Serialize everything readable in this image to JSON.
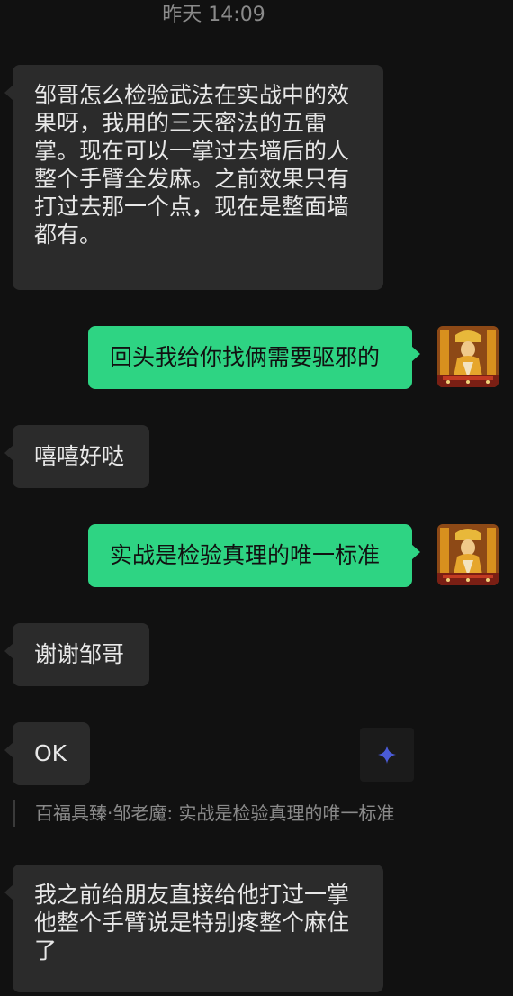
{
  "chat": {
    "timestamp": "昨天 14:09",
    "messages": [
      {
        "side": "in",
        "text": "邹哥怎么检验武法在实战中的效果呀，我用的三天密法的五雷掌。现在可以一掌过去墙后的人整个手臂全发麻。之前效果只有打过去那一个点，现在是整面墙都有。"
      },
      {
        "side": "out",
        "text": "回头我给你找俩需要驱邪的"
      },
      {
        "side": "in",
        "text": "嘻嘻好哒"
      },
      {
        "side": "out",
        "text": "实战是检验真理的唯一标准"
      },
      {
        "side": "in",
        "text": "谢谢邹哥"
      },
      {
        "side": "in",
        "text": "OK"
      },
      {
        "side": "in",
        "text": "我之前给朋友直接给他打过一掌他整个手臂说是特别疼整个麻住了"
      }
    ],
    "quote": "百福具臻·邹老魔: 实战是检验真理的唯一标准",
    "icons": {
      "avatar": "deity-figure-avatar-icon",
      "sparkle": "sparkle-icon"
    },
    "colors": {
      "background": "#111111",
      "incoming_bubble": "#2b2b2b",
      "outgoing_bubble": "#2ed483",
      "accent_sparkle": "#4a5bd6"
    }
  }
}
